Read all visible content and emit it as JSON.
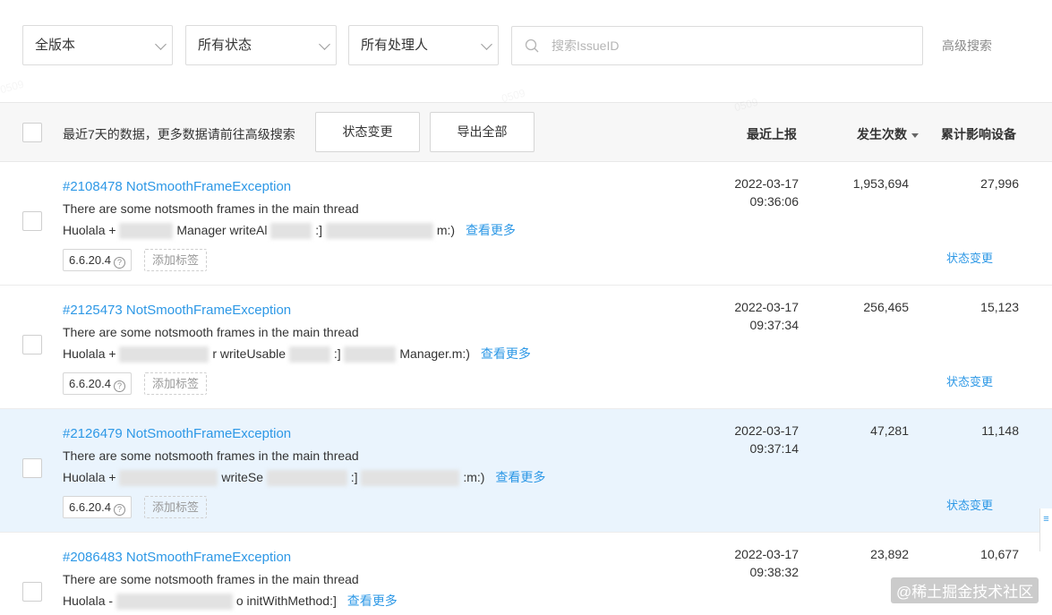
{
  "filters": {
    "version": "全版本",
    "status": "所有状态",
    "assignee": "所有处理人",
    "search_placeholder": "搜索IssueID",
    "advanced": "高级搜索"
  },
  "header": {
    "hint": "最近7天的数据，更多数据请前往高级搜索",
    "btn_status": "状态变更",
    "btn_export": "导出全部",
    "col_last": "最近上报",
    "col_count": "发生次数",
    "col_devices": "累计影响设备"
  },
  "rows": [
    {
      "title": "#2108478 NotSmoothFrameException",
      "message": "There are some notsmooth frames in the main thread",
      "stack_a": "Huolala +",
      "stack_b": "Manager writeAl",
      "stack_c": ":]",
      "stack_d": "m:)",
      "more": "查看更多",
      "version": "6.6.20.4",
      "tag": "添加标签",
      "date": "2022-03-17",
      "time": "09:36:06",
      "count": "1,953,694",
      "devices": "27,996",
      "state": "状态变更"
    },
    {
      "title": "#2125473 NotSmoothFrameException",
      "message": "There are some notsmooth frames in the main thread",
      "stack_a": "Huolala +",
      "stack_b": "r writeUsable",
      "stack_c": ":]",
      "stack_d": "Manager.m:)",
      "more": "查看更多",
      "version": "6.6.20.4",
      "tag": "添加标签",
      "date": "2022-03-17",
      "time": "09:37:34",
      "count": "256,465",
      "devices": "15,123",
      "state": "状态变更"
    },
    {
      "title": "#2126479 NotSmoothFrameException",
      "message": "There are some notsmooth frames in the main thread",
      "stack_a": "Huolala +",
      "stack_b": "writeSe",
      "stack_c": ":]",
      "stack_d": ":m:)",
      "more": "查看更多",
      "version": "6.6.20.4",
      "tag": "添加标签",
      "date": "2022-03-17",
      "time": "09:37:14",
      "count": "47,281",
      "devices": "11,148",
      "state": "状态变更"
    },
    {
      "title": "#2086483 NotSmoothFrameException",
      "message": "There are some notsmooth frames in the main thread",
      "stack_a": "Huolala -",
      "stack_b": "o initWithMethod:]",
      "more": "查看更多",
      "date": "2022-03-17",
      "time": "09:38:32",
      "count": "23,892",
      "devices": "10,677"
    }
  ],
  "brand": "@稀土掘金技术社区",
  "colors": {
    "link": "#2d98e6",
    "highlight_row": "#eaf4fd",
    "header_bg": "#f7f7f7"
  }
}
